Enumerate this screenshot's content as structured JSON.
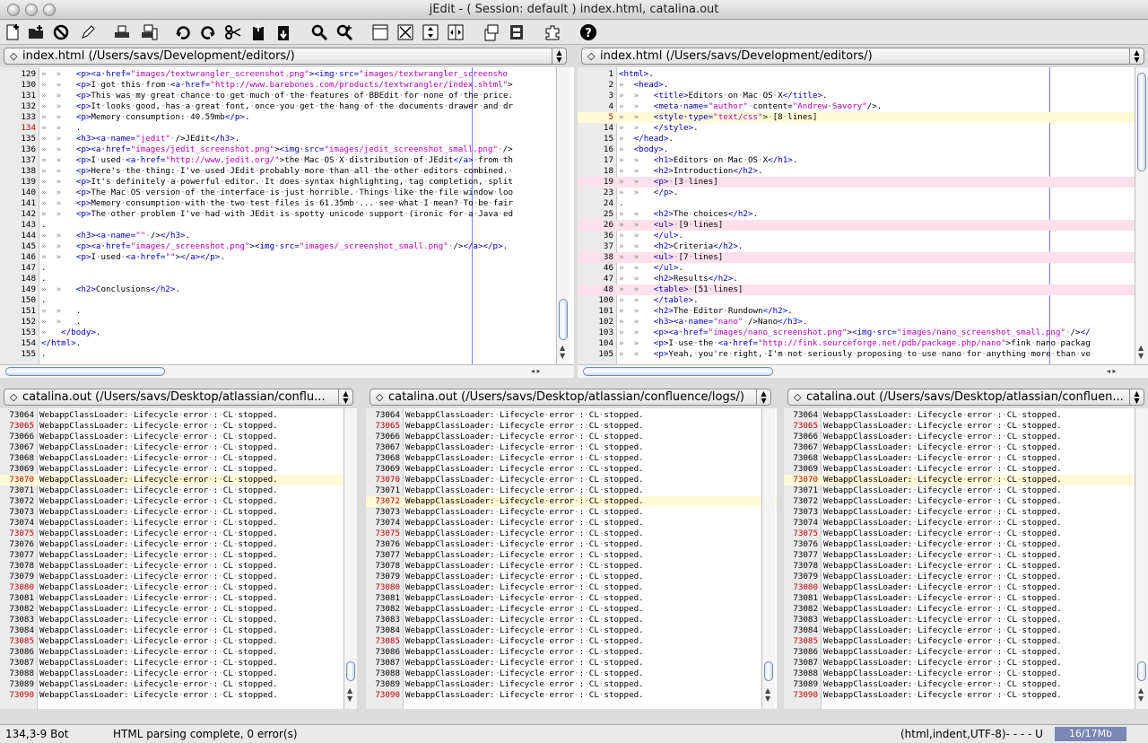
{
  "window": {
    "title": "jEdit - ( Session: default ) index.html, catalina.out"
  },
  "toolbar": [
    "new-file",
    "open-file",
    "close-file",
    "edit-pencil",
    "print",
    "page-setup",
    "undo",
    "redo",
    "cut",
    "copy",
    "paste",
    "find",
    "find-next",
    "unsplit",
    "split",
    "split-vertical",
    "split-horizontal",
    "buffer-1",
    "buffer-2",
    "plugins",
    "help"
  ],
  "panes": {
    "left": {
      "selector": "index.html (/Users/savs/Development/editors/)"
    },
    "right": {
      "selector": "index.html (/Users/savs/Development/editors/)"
    },
    "log1": {
      "selector": "catalina.out (/Users/savs/Desktop/atlassian/conflu..."
    },
    "log2": {
      "selector": "catalina.out (/Users/savs/Desktop/atlassian/confluence/logs/)"
    },
    "log3": {
      "selector": "catalina.out (/Users/savs/Desktop/atlassian/confluen..."
    }
  },
  "left_lines": [
    {
      "n": "129",
      "t": "»  »   <p><a·href=\"images/textwrangler_screenshot.png\"><img·src=\"images/textwrangler_screensho"
    },
    {
      "n": "130",
      "t": "»  »   <p>I·got·this·from·<a·href=\"http://www.barebones.com/products/textwrangler/index.shtml\">"
    },
    {
      "n": "131",
      "t": "»  »   <p>This·was·my·great·chance·to·get·much·of·the·features·of·BBEdit·for·none·of·the·price."
    },
    {
      "n": "132",
      "t": "»  »   <p>It·looks·good,·has·a·great·font,·once·you·get·the·hang·of·the·documents·drawer·and·dr"
    },
    {
      "n": "133",
      "t": "»  »   <p>Memory·consumption:·40.59mb</p>."
    },
    {
      "n": "134",
      "t": "»  »   .",
      "red": true
    },
    {
      "n": "135",
      "t": "»  »   <h3><a·name=\"jedit\"·/>JEdit</h3>."
    },
    {
      "n": "136",
      "t": "»  »   <p><a·href=\"images/jedit_screenshot.png\"><img·src=\"images/jedit_screenshot_small.png\"·/>"
    },
    {
      "n": "137",
      "t": "»  »   <p>I·used·<a·href=\"http://www.jedit.org/\">the·Mac·OS·X·distribution·of·JEdit</a>·from·th"
    },
    {
      "n": "138",
      "t": "»  »   <p>Here's·the·thing:·I've·used·JEdit·probably·more·than·all·the·other·editors·combined.·"
    },
    {
      "n": "139",
      "t": "»  »   <p>It's·definitely·a·powerful·editor.·It·does·syntax·highlighting,·tag·completion,·split"
    },
    {
      "n": "140",
      "t": "»  »   <p>The·Mac·OS·version·of·the·interface·is·just·horrible.·Things·like·the·file·window·loo"
    },
    {
      "n": "141",
      "t": "»  »   <p>Memory·consumption·with·the·two·test·files·is·61.35mb·...·see·what·I·mean?·To·be·fair"
    },
    {
      "n": "142",
      "t": "»  »   <p>The·other·problem·I've·had·with·JEdit·is·spotty·unicode·support·(ironic·for·a·Java·ed"
    },
    {
      "n": "143",
      "t": "."
    },
    {
      "n": "144",
      "t": "»  »   <h3><a·name=\"\"·/></h3>."
    },
    {
      "n": "145",
      "t": "»  »   <p><a·href=\"images/_screenshot.png\"><img·src=\"images/_screenshot_small.png\"·/></a></p>."
    },
    {
      "n": "146",
      "t": "»  »   <p>I·used·<a·href=\"\"></a></p>."
    },
    {
      "n": "147",
      "t": "."
    },
    {
      "n": "148",
      "t": "."
    },
    {
      "n": "149",
      "t": "»  »   <h2>Conclusions</h2>."
    },
    {
      "n": "150",
      "t": "."
    },
    {
      "n": "151",
      "t": "»  »   ."
    },
    {
      "n": "152",
      "t": "»  »   ."
    },
    {
      "n": "153",
      "t": "»   </body>."
    },
    {
      "n": "154",
      "t": "</html>."
    },
    {
      "n": "155",
      "t": "."
    }
  ],
  "right_lines": [
    {
      "n": "1",
      "t": "<html>."
    },
    {
      "n": "2",
      "t": "»  <head>."
    },
    {
      "n": "3",
      "t": "»  »   <title>Editors·on·Mac·OS·X</title>."
    },
    {
      "n": "4",
      "t": "»  »   <meta·name=\"author\"·content=\"Andrew·Savory\"/>."
    },
    {
      "n": "5",
      "t": "»  »   <style·type=\"text/css\">·[8·lines]",
      "red": true,
      "hl": true
    },
    {
      "n": "14",
      "t": "»  »   </style>."
    },
    {
      "n": "15",
      "t": "»  </head>."
    },
    {
      "n": "16",
      "t": "»  <body>."
    },
    {
      "n": "17",
      "t": "»  »   <h1>Editors·on·Mac·OS·X</h1>."
    },
    {
      "n": "18",
      "t": "»  »   <h2>Introduction</h2>."
    },
    {
      "n": "19",
      "t": "»  »   <p>·[3·lines]",
      "fold": true
    },
    {
      "n": "23",
      "t": "»  »   </p>."
    },
    {
      "n": "24",
      "t": "."
    },
    {
      "n": "25",
      "t": "»  »   <h2>The·choices</h2>."
    },
    {
      "n": "26",
      "t": "»  »   <ul>·[9·lines]",
      "fold": true
    },
    {
      "n": "36",
      "t": "»  »   </ul>."
    },
    {
      "n": "37",
      "t": "»  »   <h2>Criteria</h2>."
    },
    {
      "n": "38",
      "t": "»  »   <ul>·[7·lines]",
      "fold": true
    },
    {
      "n": "46",
      "t": "»  »   </ul>."
    },
    {
      "n": "47",
      "t": "»  »   <h2>Results</h2>."
    },
    {
      "n": "48",
      "t": "»  »   <table>·[51·lines]",
      "fold": true
    },
    {
      "n": "100",
      "t": "»  »   </table>."
    },
    {
      "n": "101",
      "t": "»  »   <h2>The·Editor·Rundown</h2>."
    },
    {
      "n": "102",
      "t": "»  »   <h3><a·name=\"nano\"·/>Nano</h3>."
    },
    {
      "n": "103",
      "t": "»  »   <p><a·href=\"images/nano_screenshot.png\"><img·src=\"images/nano_screenshot_small.png\"·/></"
    },
    {
      "n": "104",
      "t": "»  »   <p>I·use·the·<a·href=\"http://fink.sourceforge.net/pdb/package.php/nano\">fink·nano·packag"
    },
    {
      "n": "105",
      "t": "»  »   <p>Yeah,·you're·right,·I'm·not·seriously·proposing·to·use·nano·for·anything·more·than·ve"
    }
  ],
  "log_text": "WebappClassLoader:·Lifecycle·error·:·CL·stopped.",
  "log_lines": [
    "73064",
    "73065",
    "73066",
    "73067",
    "73068",
    "73069",
    "73070",
    "73071",
    "73072",
    "73073",
    "73074",
    "73075",
    "73076",
    "73077",
    "73078",
    "73079",
    "73080",
    "73081",
    "73082",
    "73083",
    "73084",
    "73085",
    "73086",
    "73087",
    "73088",
    "73089",
    "73090"
  ],
  "log_red": [
    "73065",
    "73070",
    "73075",
    "73080",
    "73085",
    "73090"
  ],
  "log2_red": [
    "73065",
    "73070",
    "73072",
    "73075",
    "73080",
    "73085",
    "73090"
  ],
  "status": {
    "position": "134,3-9 Bot",
    "message": "HTML parsing complete, 0 error(s)",
    "mode": "(html,indent,UTF-8)- - - - U",
    "memory": "16/17Mb"
  },
  "colors": {
    "tag": "#0000c8",
    "string": "#c000c0",
    "highlight": "#fffbd7",
    "fold": "#fde0ec",
    "memory": "#7a86b3"
  }
}
